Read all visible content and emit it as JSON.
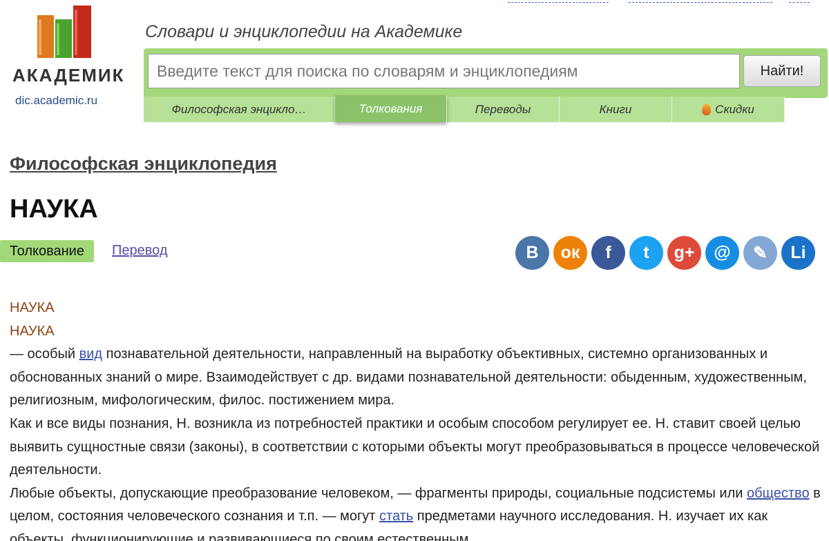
{
  "logo": {
    "name": "АКАДЕМИК",
    "url": "dic.academic.ru"
  },
  "header": {
    "tagline": "Словари и энциклопедии на Академике"
  },
  "search": {
    "placeholder": "Введите текст для поиска по словарям и энциклопедиям",
    "button_label": "Найти!"
  },
  "tabs": [
    {
      "label": "Философская энцикло…",
      "active": false
    },
    {
      "label": "Толкования",
      "active": true
    },
    {
      "label": "Переводы",
      "active": false
    },
    {
      "label": "Книги",
      "active": false
    },
    {
      "label": "Скидки",
      "active": false,
      "icon": "fire-icon"
    }
  ],
  "dictionary_title": "Философская энциклопедия",
  "word_title": "НАУКА",
  "view_tabs": {
    "interpretation": "Толкование",
    "translation": "Перевод"
  },
  "social": [
    {
      "name": "vk-icon",
      "glyph": "B",
      "color": "#4a76a8"
    },
    {
      "name": "odnoklassniki-icon",
      "glyph": "ок",
      "color": "#ee8208"
    },
    {
      "name": "facebook-icon",
      "glyph": "f",
      "color": "#3b5998"
    },
    {
      "name": "twitter-icon",
      "glyph": "t",
      "color": "#1da1f2"
    },
    {
      "name": "google-plus-icon",
      "glyph": "g+",
      "color": "#dd4b39"
    },
    {
      "name": "mail-icon",
      "glyph": "@",
      "color": "#168de2"
    },
    {
      "name": "livejournal-icon",
      "glyph": "✎",
      "color": "#83a8d6"
    },
    {
      "name": "liveinternet-icon",
      "glyph": "Li",
      "color": "#1a73c9"
    }
  ],
  "article": {
    "headword1": "НАУКА",
    "headword2": "НАУКА",
    "p1_a": "— особый ",
    "p1_link": "вид",
    "p1_b": " познавательной деятельности, направленный на выработку объективных, системно организованных и обоснованных знаний о мире. Взаимодействует с др. видами познавательной деятельности: обыденным, художественным, религиозным, мифологическим, филос. постижением мира.",
    "p2": "Как и все виды познания, Н. возникла из потребностей практики и особым способом регулирует ее. Н. ставит своей целью выявить сущностные связи (законы), в соответствии с которыми объекты могут преобразовываться в процессе человеческой деятельности.",
    "p3_a": "Любые объекты, допускающие преобразование человеком, — фрагменты природы, социальные подсистемы или ",
    "p3_link1": "общество",
    "p3_b": " в целом, состояния человеческого сознания и т.п. — могут ",
    "p3_link2": "стать",
    "p3_c": " предметами научного исследования. Н. изучает их как объекты, функционирующие и развивающиеся по своим естественным"
  }
}
